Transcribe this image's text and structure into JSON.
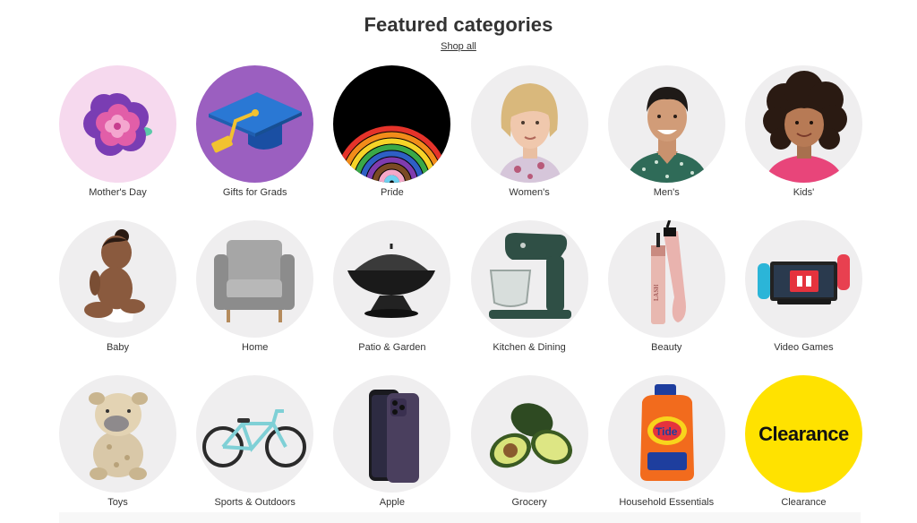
{
  "section": {
    "title": "Featured categories",
    "shop_all_label": "Shop all"
  },
  "categories": [
    {
      "label": "Mother's Day",
      "icon": "flower-icon",
      "bg": "#f6d9ee"
    },
    {
      "label": "Gifts for Grads",
      "icon": "graduation-cap-icon",
      "bg": "#9b5fc0"
    },
    {
      "label": "Pride",
      "icon": "rainbow-icon",
      "bg": "#000000"
    },
    {
      "label": "Women's",
      "icon": "woman-portrait-icon",
      "bg": "#efeeef"
    },
    {
      "label": "Men's",
      "icon": "man-portrait-icon",
      "bg": "#efeeef"
    },
    {
      "label": "Kids'",
      "icon": "child-portrait-icon",
      "bg": "#efeeef"
    },
    {
      "label": "Baby",
      "icon": "baby-icon",
      "bg": "#efeeef"
    },
    {
      "label": "Home",
      "icon": "armchair-icon",
      "bg": "#efeeef"
    },
    {
      "label": "Patio & Garden",
      "icon": "fire-pit-icon",
      "bg": "#efeeef"
    },
    {
      "label": "Kitchen & Dining",
      "icon": "stand-mixer-icon",
      "bg": "#efeeef"
    },
    {
      "label": "Beauty",
      "icon": "mascara-icon",
      "bg": "#efeeef"
    },
    {
      "label": "Video Games",
      "icon": "game-console-icon",
      "bg": "#efeeef"
    },
    {
      "label": "Toys",
      "icon": "plush-toy-icon",
      "bg": "#efeeef"
    },
    {
      "label": "Sports & Outdoors",
      "icon": "bicycle-icon",
      "bg": "#efeeef"
    },
    {
      "label": "Apple",
      "icon": "smartphone-icon",
      "bg": "#efeeef"
    },
    {
      "label": "Grocery",
      "icon": "avocado-icon",
      "bg": "#efeeef"
    },
    {
      "label": "Household Essentials",
      "icon": "detergent-icon",
      "bg": "#efeeef"
    },
    {
      "label": "Clearance",
      "icon": "clearance-badge",
      "bg": "#ffe200",
      "badge_text": "Clearance"
    }
  ]
}
